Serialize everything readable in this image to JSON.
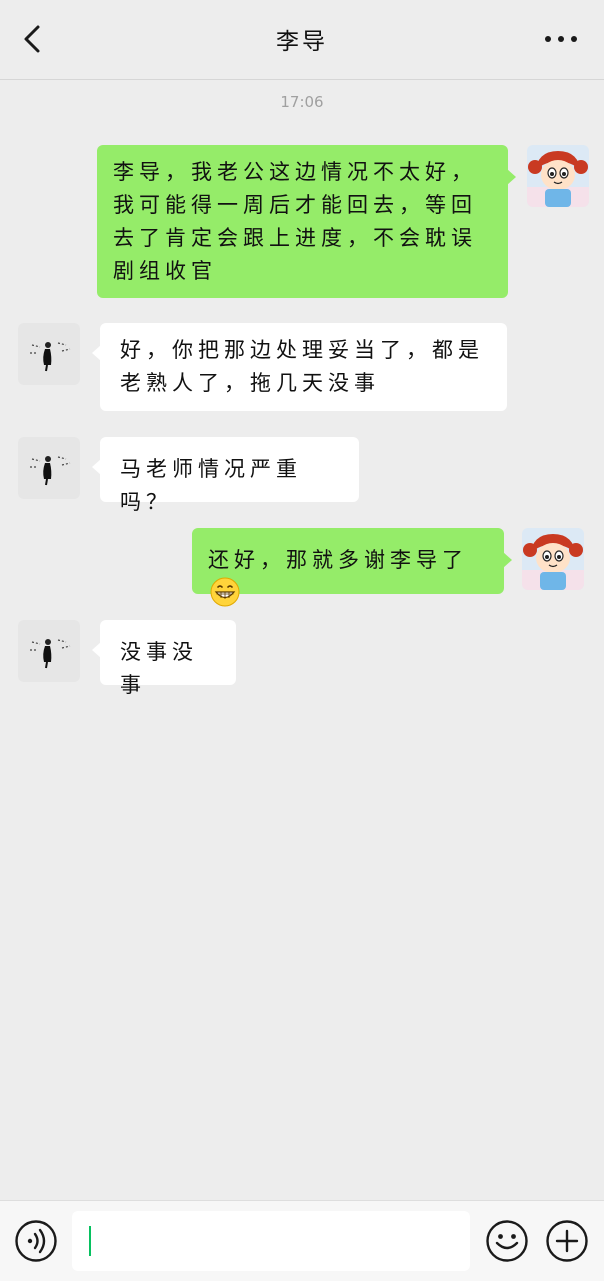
{
  "header": {
    "title": "李导"
  },
  "chat": {
    "timestamp": "17:06",
    "messages": [
      {
        "sender": "me",
        "text": "李导，我老公这边情况不太好，我可能得一周后才能回去，等回去了肯定会跟上进度，不会耽误剧组收官"
      },
      {
        "sender": "other",
        "text": "好，你把那边处理妥当了，都是老熟人了，拖几天没事"
      },
      {
        "sender": "other",
        "text": "马老师情况严重吗？"
      },
      {
        "sender": "me",
        "text": "还好，那就多谢李导了",
        "emoji": "grinning-face-emoji"
      },
      {
        "sender": "other",
        "text": "没事没事"
      }
    ]
  },
  "input": {
    "value": "",
    "placeholder": ""
  },
  "colors": {
    "background": "#ededed",
    "my_bubble": "#95ec69",
    "other_bubble": "#ffffff",
    "cursor": "#07c160"
  },
  "icons": [
    "back-arrow-icon",
    "more-dots-icon",
    "voice-icon",
    "emoji-icon",
    "plus-icon"
  ]
}
